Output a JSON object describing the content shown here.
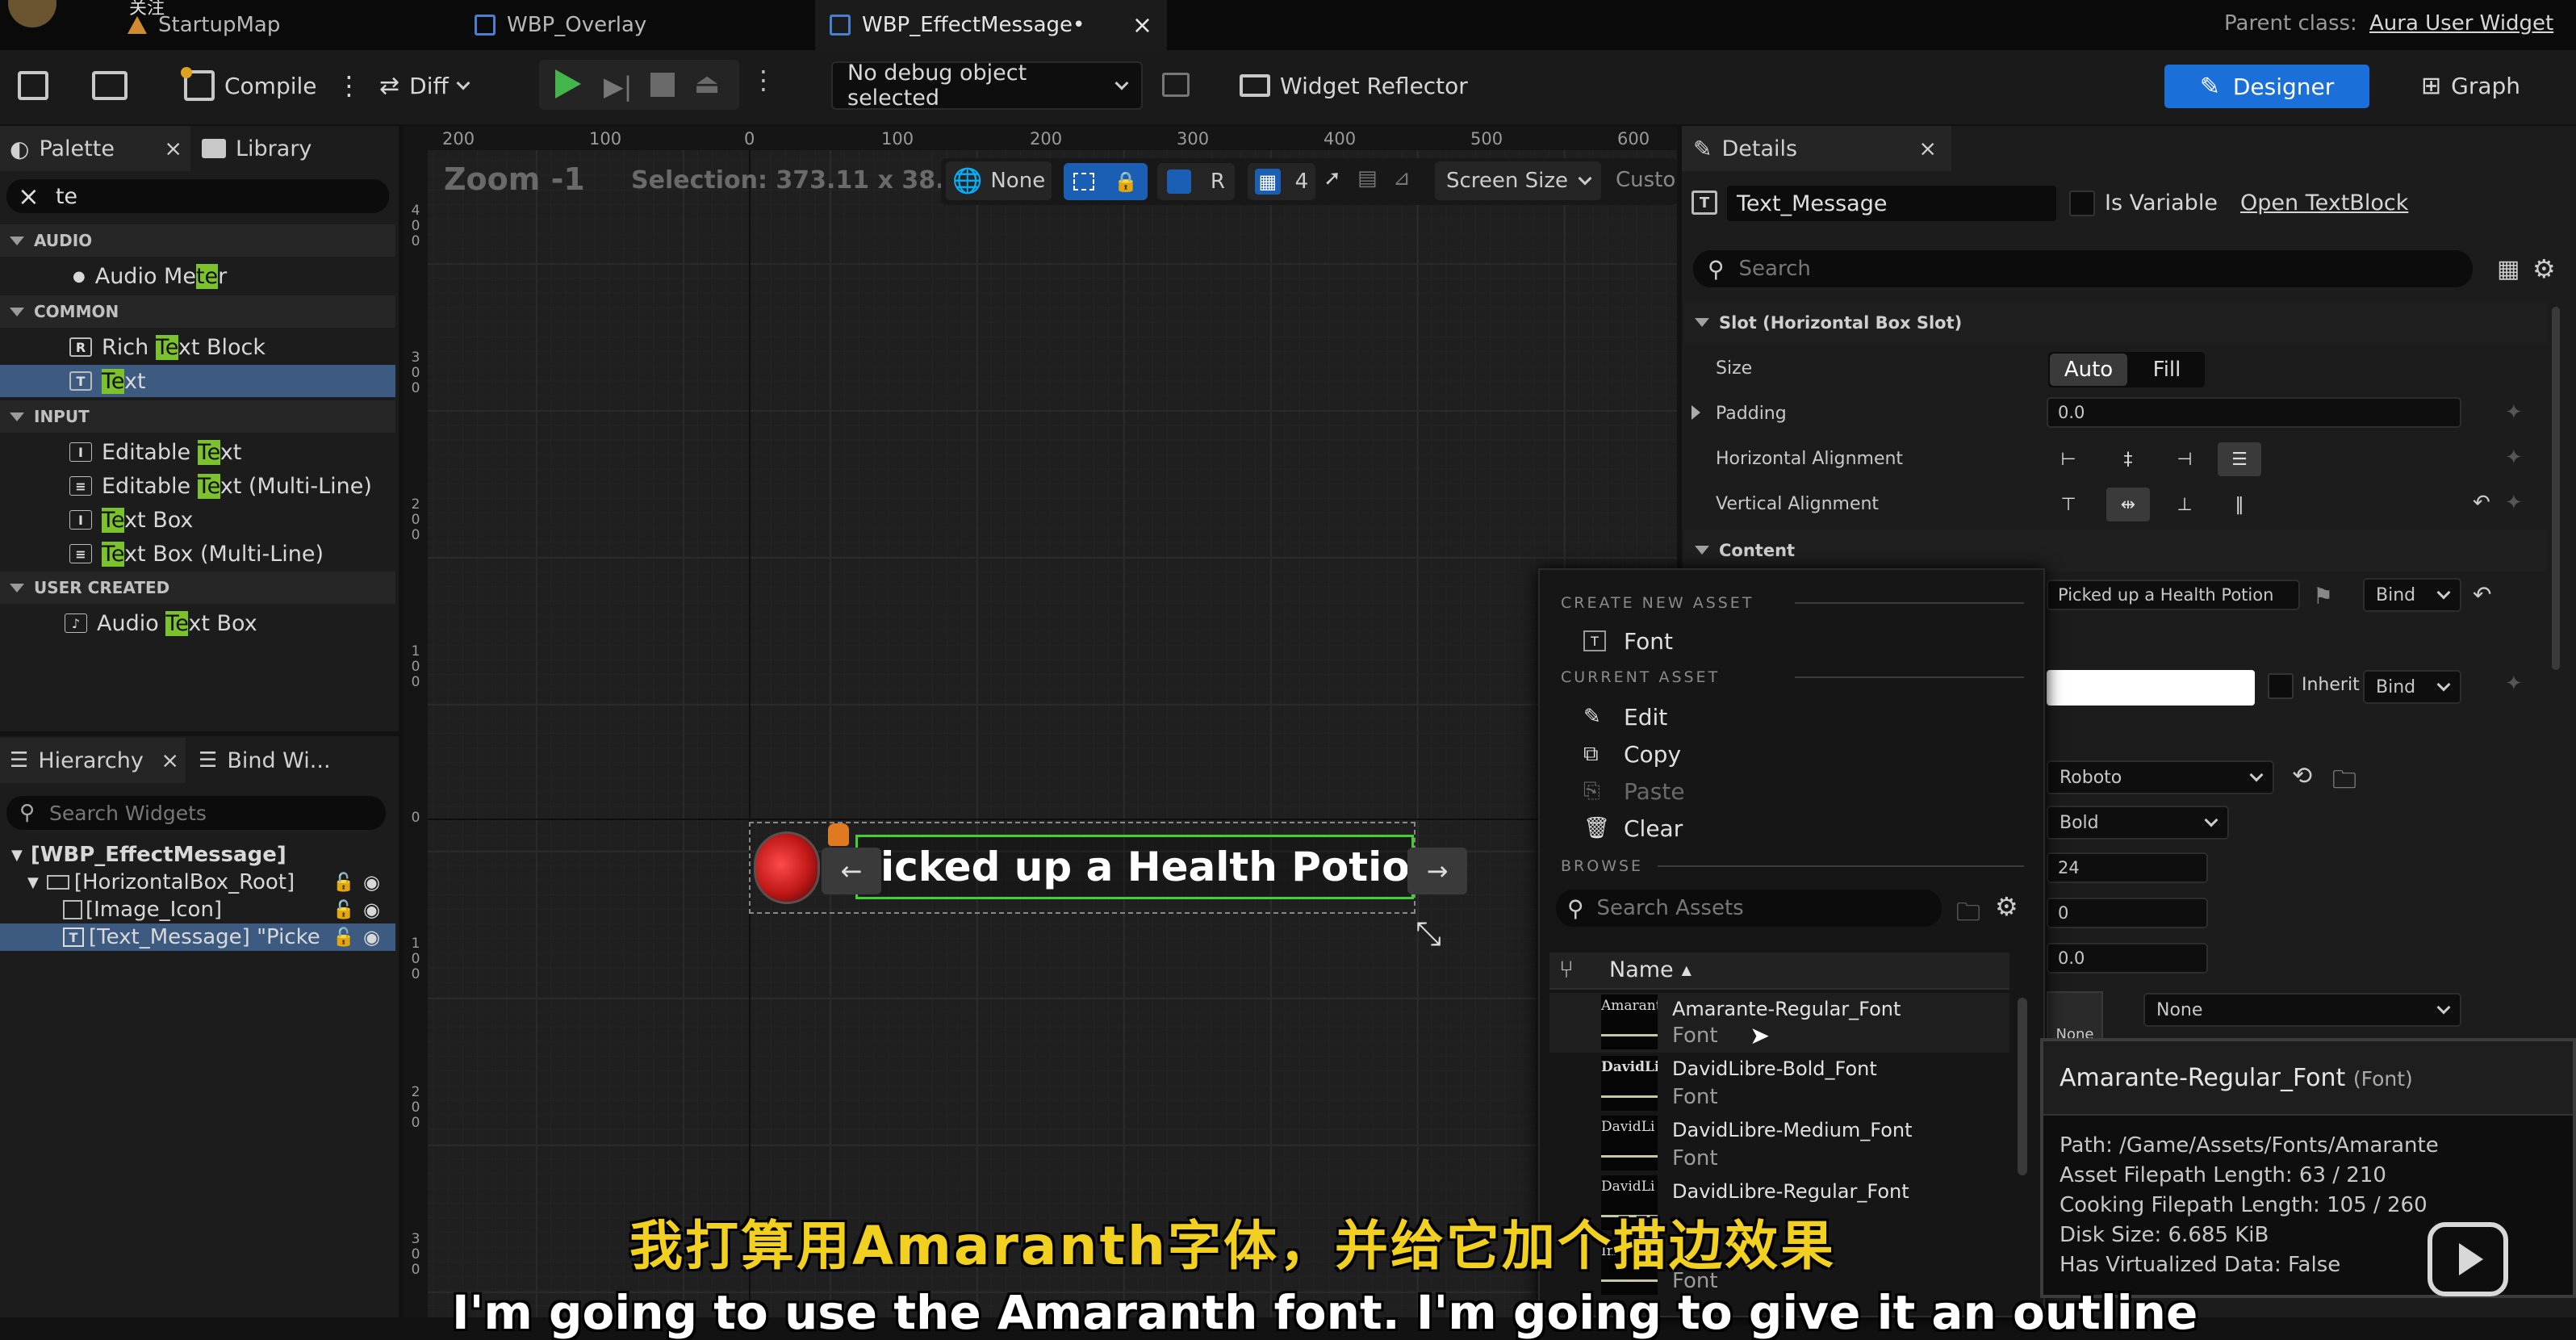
{
  "tabs": [
    {
      "label": "关注",
      "icon": "avatar"
    },
    {
      "label": "StartupMap",
      "icon": "level-icon"
    },
    {
      "label": "WBP_Overlay",
      "icon": "widget-blueprint-icon"
    },
    {
      "label": "WBP_EffectMessage•",
      "icon": "widget-blueprint-icon",
      "close": "×"
    }
  ],
  "parent_class": {
    "label": "Parent class:",
    "value": "Aura User Widget"
  },
  "toolbar": {
    "compile": "Compile",
    "diff": "Diff",
    "debug": "No debug object selected",
    "reflector": "Widget Reflector",
    "designer": "Designer",
    "graph": "Graph"
  },
  "palette": {
    "tab": "Palette",
    "close": "×",
    "library": "Library",
    "search": "te",
    "clear": "×",
    "sections": [
      {
        "title": "AUDIO",
        "items": [
          {
            "pre": "Audio Me",
            "hl": "te",
            "post": "r",
            "icon": "dot-icon"
          }
        ]
      },
      {
        "title": "COMMON",
        "items": [
          {
            "pre": "Rich ",
            "hl": "Te",
            "post": "xt Block",
            "icon": "rich-text-icon"
          },
          {
            "pre": "",
            "hl": "Te",
            "post": "xt",
            "icon": "text-icon",
            "selected": true
          }
        ]
      },
      {
        "title": "INPUT",
        "items": [
          {
            "pre": "Editable ",
            "hl": "Te",
            "post": "xt",
            "icon": "editable-text-icon"
          },
          {
            "pre": "Editable ",
            "hl": "Te",
            "post": "xt (Multi-Line)",
            "icon": "editable-multiline-icon"
          },
          {
            "pre": "",
            "hl": "Te",
            "post": "xt Box",
            "icon": "text-box-icon"
          },
          {
            "pre": "",
            "hl": "Te",
            "post": "xt Box (Multi-Line)",
            "icon": "text-box-multiline-icon"
          }
        ]
      },
      {
        "title": "USER CREATED",
        "items": [
          {
            "pre": "Audio ",
            "hl": "Te",
            "post": "xt Box",
            "icon": "audio-text-box-icon"
          }
        ]
      }
    ]
  },
  "hierarchy": {
    "tab": "Hierarchy",
    "close": "×",
    "bind": "Bind Wi...",
    "search_placeholder": "Search Widgets",
    "rows": [
      "[WBP_EffectMessage]",
      "[HorizontalBox_Root]",
      "[Image_Icon]",
      "[Text_Message] \"Picke"
    ]
  },
  "viewport": {
    "zoom": "Zoom -1",
    "selection": "Selection: 373.11 x 38.4",
    "none": "None",
    "r": "R",
    "grid": "4",
    "screen_size": "Screen Size",
    "custom": "Custo",
    "ruler_top": [
      "200",
      "100",
      "0",
      "100",
      "200",
      "300",
      "400",
      "500",
      "600"
    ],
    "ruler_left": [
      "4\n0\n0",
      "3\n0\n0",
      "2\n0\n0",
      "1\n0\n0",
      "0",
      "1\n0\n0",
      "2\n0\n0",
      "3\n0\n0"
    ],
    "widget_text": "icked up a Health Potion",
    "left_arrow": "←",
    "right_arrow": "→"
  },
  "details": {
    "tab": "Details",
    "close": "×",
    "name": "Text_Message",
    "is_variable": "Is Variable",
    "open": "Open TextBlock",
    "search_placeholder": "Search",
    "slot_section": "Slot (Horizontal Box Slot)",
    "size_label": "Size",
    "auto": "Auto",
    "fill": "Fill",
    "padding_label": "Padding",
    "padding_value": "0.0",
    "halign_label": "Horizontal Alignment",
    "valign_label": "Vertical Alignment",
    "content_section": "Content",
    "text_value": "Picked up a Health Potion",
    "bind": "Bind",
    "inherit": "Inherit",
    "font_family": "Roboto",
    "typeface": "Bold",
    "size": "24",
    "letter_spacing": "0",
    "skew": "0.0",
    "none_btn": "None",
    "none_drop": "None"
  },
  "asset_menu": {
    "create_header": "CREATE NEW ASSET",
    "font": "Font",
    "current_header": "CURRENT ASSET",
    "edit": "Edit",
    "copy": "Copy",
    "paste": "Paste",
    "clear": "Clear",
    "browse_header": "BROWSE",
    "search_placeholder": "Search Assets",
    "name_col": "Name",
    "assets": [
      {
        "thumb": "Amarant",
        "name": "Amarante-Regular_Font",
        "type": "Font"
      },
      {
        "thumb": "DavidLi",
        "name": "DavidLibre-Bold_Font",
        "type": "Font"
      },
      {
        "thumb": "DavidLi",
        "name": "DavidLibre-Medium_Font",
        "type": "Font"
      },
      {
        "thumb": "DavidLi",
        "name": "DavidLibre-Regular_Font",
        "type": "Font"
      },
      {
        "thumb": "In",
        "name": "In",
        "type": "Font"
      }
    ]
  },
  "tooltip": {
    "title": "Amarante-Regular_Font",
    "type": "(Font)",
    "path": "Path: /Game/Assets/Fonts/Amarante",
    "asset_len": "Asset Filepath Length: 63 / 210",
    "cook_len": "Cooking Filepath Length: 105 / 260",
    "disk": "Disk Size: 6.685 KiB",
    "virtual": "Has Virtualized Data: False"
  },
  "subtitles": {
    "zh": "我打算用Amaranth字体，并给它加个描边效果",
    "en": "I'm going to use the Amaranth font. I'm going to give it an outline"
  }
}
